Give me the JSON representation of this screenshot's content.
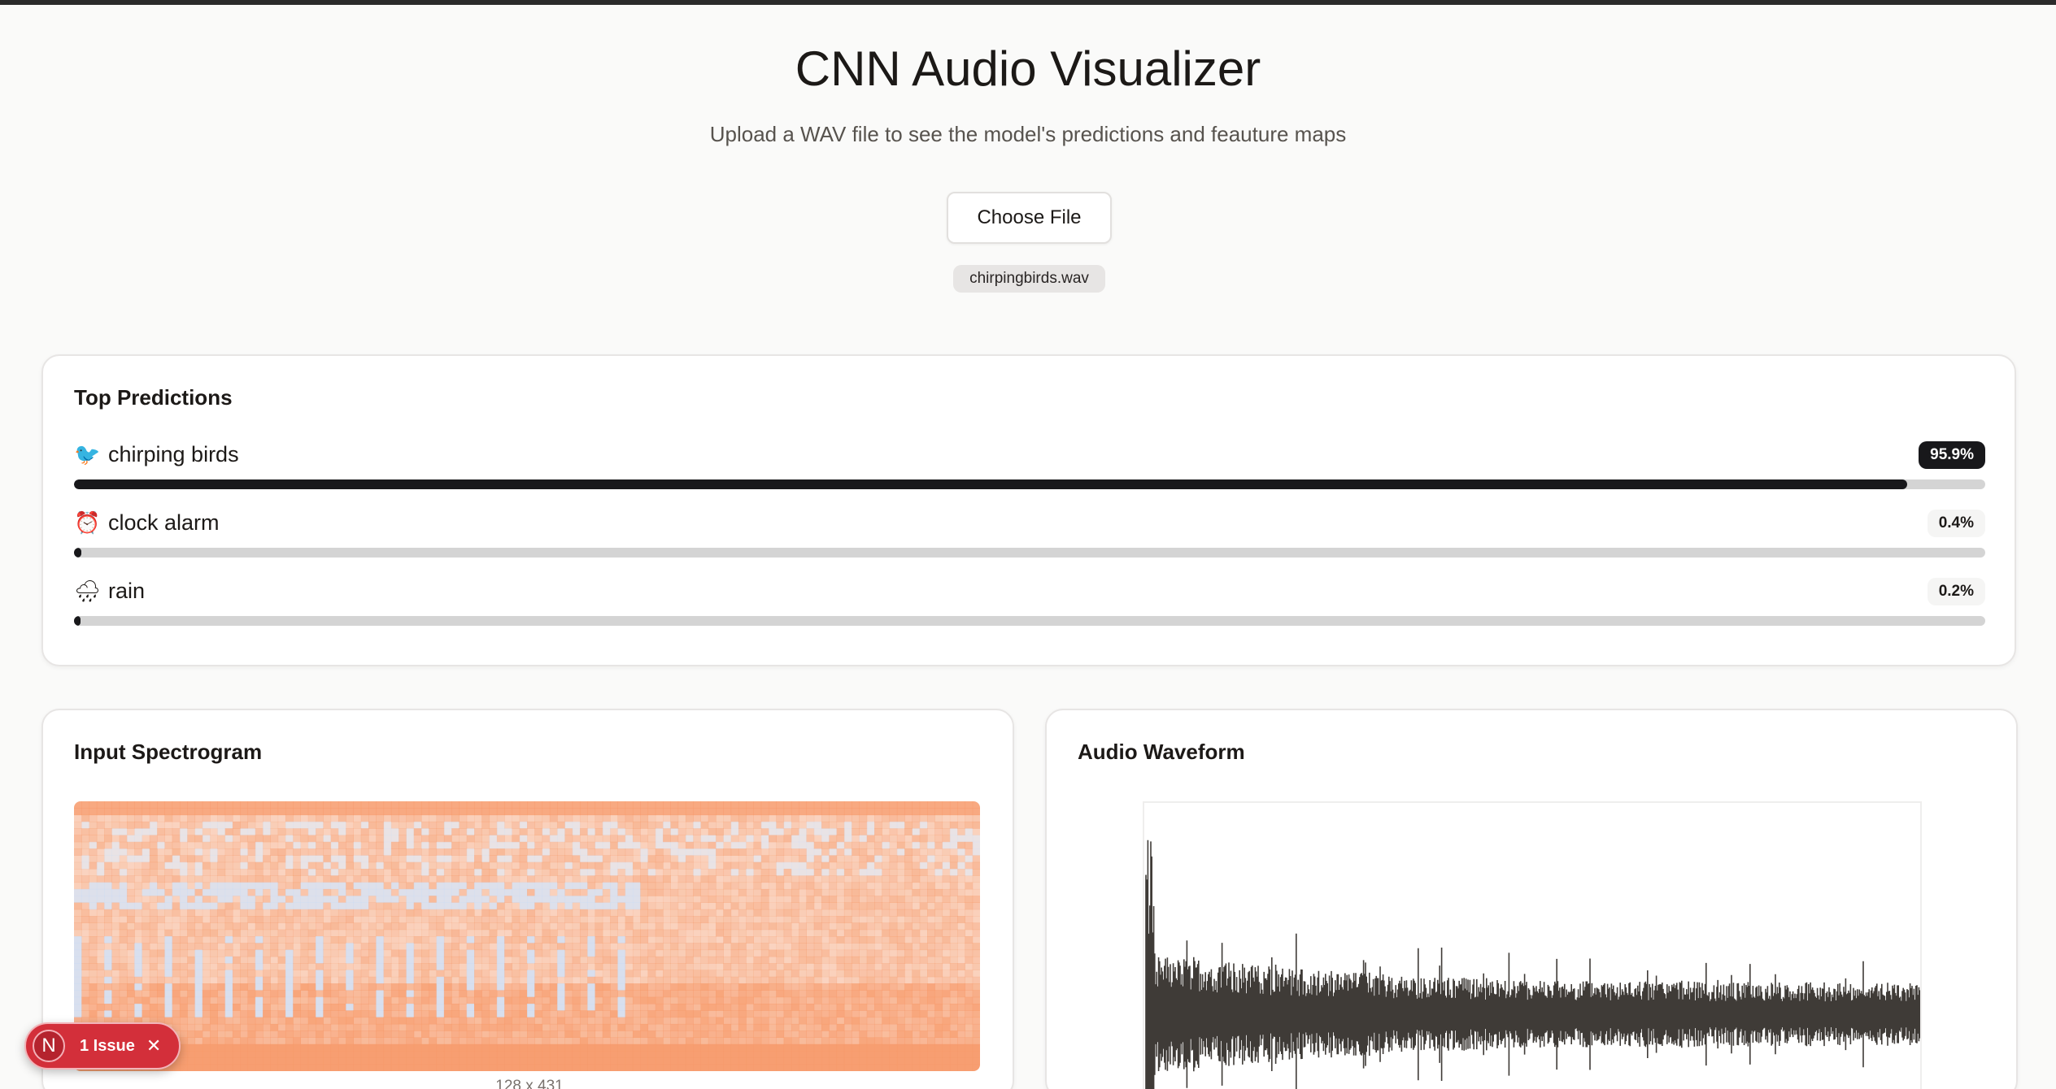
{
  "header": {
    "title": "CNN Audio Visualizer",
    "subtitle": "Upload a WAV file to see the model's predictions and feauture maps",
    "choose_file_label": "Choose File",
    "file_name": "chirpingbirds.wav"
  },
  "predictions": {
    "title": "Top Predictions",
    "items": [
      {
        "icon": "bird-icon",
        "emoji": "🐦",
        "label": "chirping birds",
        "percent_text": "95.9%",
        "value": 95.9
      },
      {
        "icon": "alarm-clock-icon",
        "emoji": "⏰",
        "label": "clock alarm",
        "percent_text": "0.4%",
        "value": 0.4
      },
      {
        "icon": "rain-cloud-icon",
        "emoji": "🌧",
        "label": "rain",
        "percent_text": "0.2%",
        "value": 0.2
      }
    ]
  },
  "spectrogram": {
    "title": "Input Spectrogram",
    "caption": "128 x 431"
  },
  "waveform": {
    "title": "Audio Waveform"
  },
  "issue_badge": {
    "initial": "N",
    "label": "1 Issue"
  },
  "colors": {
    "accent_dark": "#18181b",
    "bar_track": "#d4d4d4",
    "issue_red": "#d32f3a",
    "waveform": "#3f3b37",
    "spectrogram_warm": "#f79a6a",
    "spectrogram_cool": "#c9dcf5"
  }
}
